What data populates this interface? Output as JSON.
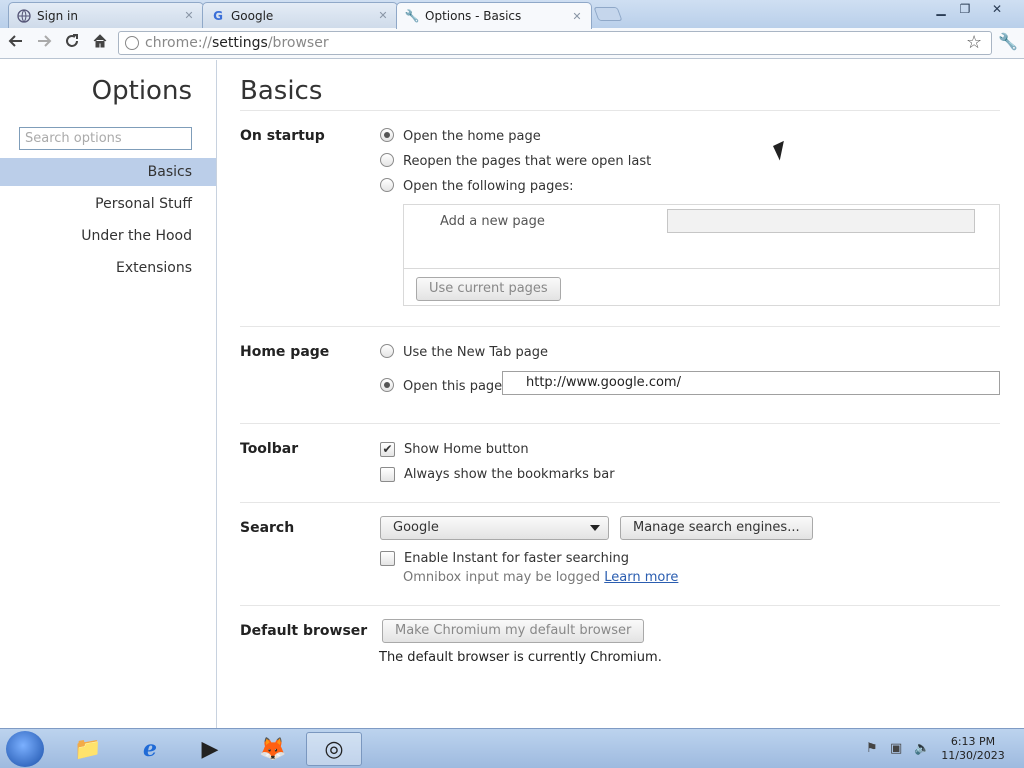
{
  "browser": {
    "tabs": [
      {
        "label": "Sign in",
        "icon": "globe-icon"
      },
      {
        "label": "Google",
        "icon": "google-icon"
      },
      {
        "label": "Options - Basics",
        "icon": "wrench-icon"
      }
    ],
    "active_tab_index": 2,
    "omnibox": {
      "scheme": "chrome://",
      "host": "settings",
      "path": "/browser"
    }
  },
  "sidebar": {
    "title": "Options",
    "search_placeholder": "Search options",
    "items": [
      {
        "label": "Basics",
        "selected": true
      },
      {
        "label": "Personal Stuff"
      },
      {
        "label": "Under the Hood"
      },
      {
        "label": "Extensions"
      }
    ]
  },
  "main": {
    "title": "Basics",
    "startup": {
      "label": "On startup",
      "options": [
        {
          "label": "Open the home page",
          "selected": true
        },
        {
          "label": "Reopen the pages that were open last"
        },
        {
          "label": "Open the following pages:"
        }
      ],
      "add_page_label": "Add a new page",
      "use_current_button": "Use current pages"
    },
    "homepage": {
      "label": "Home page",
      "new_tab_label": "Use the New Tab page",
      "open_page_label": "Open this page:",
      "url_value": "http://www.google.com/",
      "selected": "open_page"
    },
    "toolbar_section": {
      "label": "Toolbar",
      "show_home_label": "Show Home button",
      "show_home_checked": true,
      "bookmarks_label": "Always show the bookmarks bar",
      "bookmarks_checked": false
    },
    "search": {
      "label": "Search",
      "engine_selected": "Google",
      "manage_button": "Manage search engines...",
      "instant_label": "Enable Instant for faster searching",
      "instant_checked": false,
      "omnibox_note": "Omnibox input may be logged",
      "learn_more": "Learn more"
    },
    "default_browser": {
      "label": "Default browser",
      "button": "Make Chromium my default browser",
      "status": "The default browser is currently Chromium."
    }
  },
  "taskbar": {
    "items": [
      "folder-icon",
      "ie-icon",
      "media-player-icon",
      "firefox-icon",
      "chromium-icon"
    ],
    "active_item": "chromium-icon",
    "clock_time": "6:13 PM",
    "clock_date": "11/30/2023"
  }
}
